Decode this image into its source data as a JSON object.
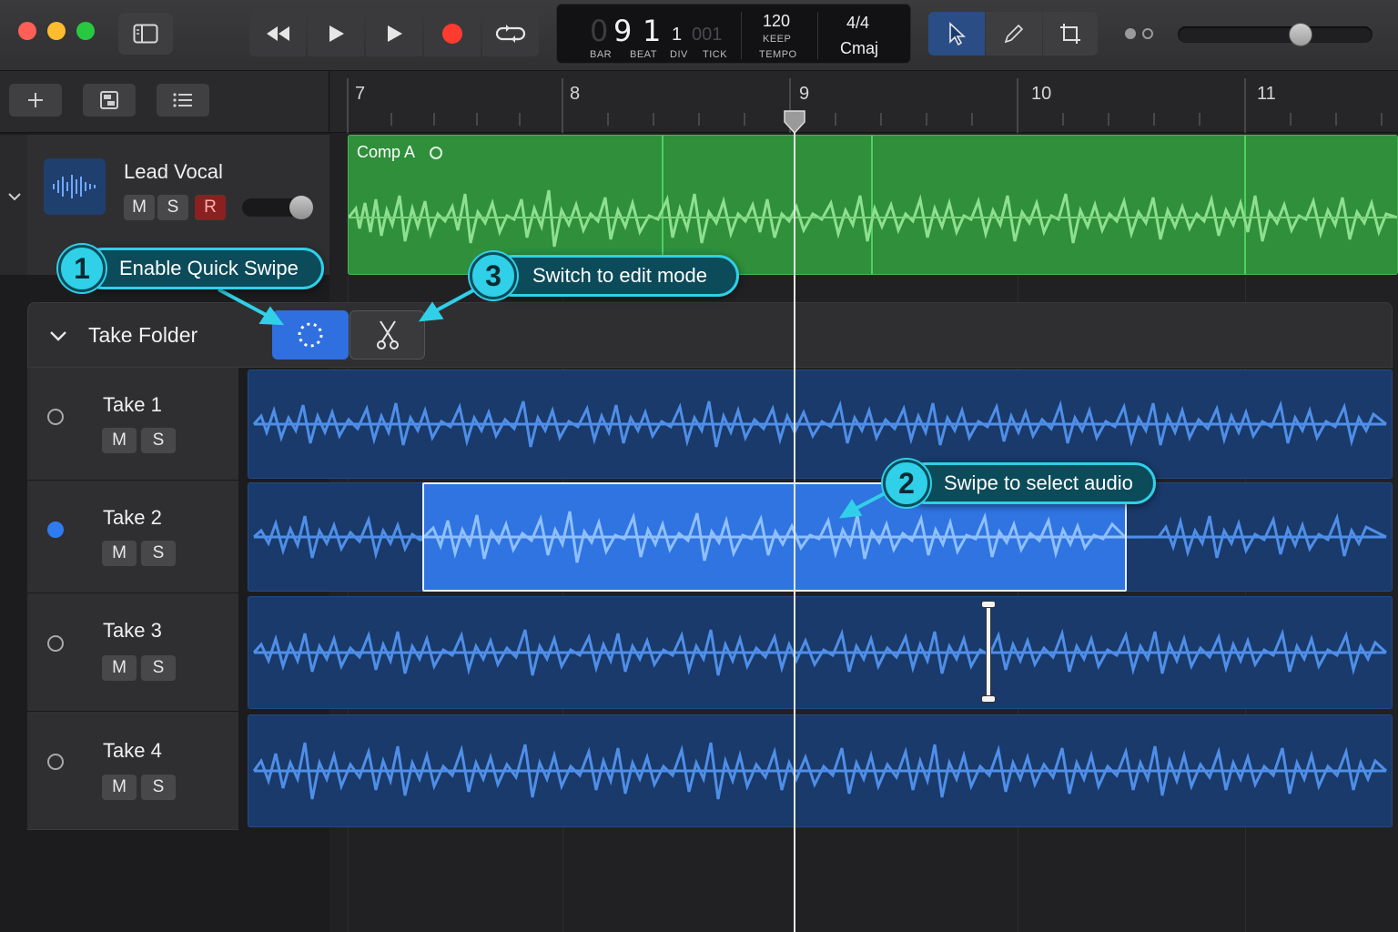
{
  "window": {
    "traffic_lights": [
      "#ff5f57",
      "#febc2e",
      "#28c840"
    ]
  },
  "toolbar": {
    "transport": [
      "rewind-icon",
      "play-icon",
      "play-icon",
      "record-icon",
      "cycle-icon"
    ],
    "record_color": "#ff3b30",
    "lcd": {
      "bar": "9",
      "beat": "1",
      "div": "1",
      "tick": "001",
      "bar_label": "BAR",
      "beat_label": "BEAT",
      "div_label": "DIV",
      "tick_label": "TICK",
      "tempo": "120",
      "tempo_mode": "KEEP",
      "tempo_label": "TEMPO",
      "signature": "4/4",
      "key": "Cmaj"
    },
    "tools": [
      "pointer-icon",
      "pencil-icon",
      "crop-icon"
    ]
  },
  "ruler": {
    "bars": [
      "7",
      "8",
      "9",
      "10",
      "11"
    ],
    "playhead_bar": 9
  },
  "lead_track": {
    "name": "Lead Vocal",
    "mute": "M",
    "solo": "S",
    "record": "R",
    "region_name": "Comp A",
    "region_color": "#2f8f3a"
  },
  "take_folder": {
    "label": "Take Folder",
    "quick_swipe_active": true,
    "takes": [
      {
        "name": "Take 1",
        "mute": "M",
        "solo": "S",
        "selected": false
      },
      {
        "name": "Take 2",
        "mute": "M",
        "solo": "S",
        "selected": true
      },
      {
        "name": "Take 3",
        "mute": "M",
        "solo": "S",
        "selected": false
      },
      {
        "name": "Take 4",
        "mute": "M",
        "solo": "S",
        "selected": false
      }
    ]
  },
  "callouts": [
    {
      "num": "1",
      "text": "Enable Quick Swipe"
    },
    {
      "num": "2",
      "text": "Swipe to select audio"
    },
    {
      "num": "3",
      "text": "Switch to edit mode"
    }
  ],
  "colors": {
    "accent_blue": "#2f6fe0",
    "callout_cyan": "#2fd0e8",
    "take_region": "#193a6a"
  }
}
